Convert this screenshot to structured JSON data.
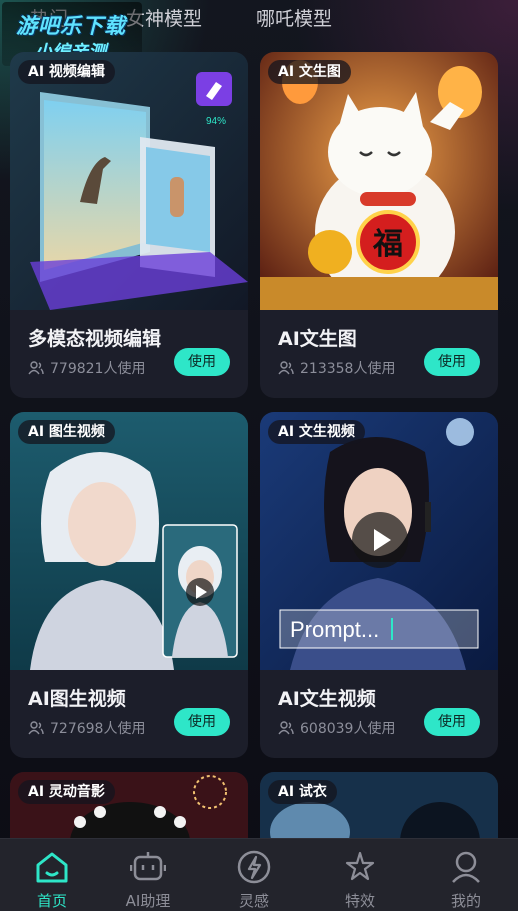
{
  "top_tabs": [
    "热门",
    "女神模型",
    "哪吒模型"
  ],
  "watermark": {
    "line1": "游吧乐下载",
    "line2": "小编亲测"
  },
  "cards": [
    {
      "tag": "AI 视频编辑",
      "title": "多模态视频编辑",
      "users": "779821人使用",
      "button": "使用",
      "overlay": {
        "progress_label": "94%"
      }
    },
    {
      "tag": "AI 文生图",
      "title": "AI文生图",
      "users": "213358人使用",
      "button": "使用",
      "overlay": {
        "sign_char": "福"
      }
    },
    {
      "tag": "AI 图生视频",
      "title": "AI图生视频",
      "users": "727698人使用",
      "button": "使用"
    },
    {
      "tag": "AI 文生视频",
      "title": "AI文生视频",
      "users": "608039人使用",
      "button": "使用",
      "overlay": {
        "prompt_text": "Prompt..."
      }
    },
    {
      "tag": "AI 灵动音影"
    },
    {
      "tag": "AI 试衣"
    }
  ],
  "bottom_nav": [
    {
      "label": "首页",
      "icon": "home-icon",
      "active": true
    },
    {
      "label": "AI助理",
      "icon": "robot-icon",
      "active": false
    },
    {
      "label": "灵感",
      "icon": "lightning-icon",
      "active": false
    },
    {
      "label": "特效",
      "icon": "effects-icon",
      "active": false
    },
    {
      "label": "我的",
      "icon": "profile-icon",
      "active": false
    }
  ],
  "colors": {
    "accent": "#2ee6c8",
    "background": "#0d0d17",
    "card": "#1c1e2a"
  }
}
